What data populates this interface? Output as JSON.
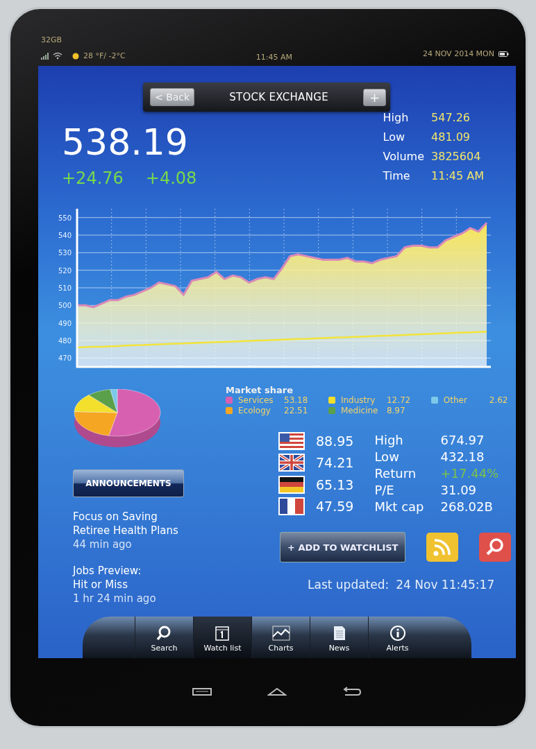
{
  "status_bar": {
    "storage": "32GB",
    "weather": "28 °F/ -2°C",
    "time": "11:45 AM",
    "date": "24 NOV 2014 MON"
  },
  "header": {
    "back": "< Back",
    "title": "STOCK EXCHANGE",
    "add": "+"
  },
  "quote": {
    "price": "538.19",
    "changes": [
      "+24.76",
      "+4.08"
    ],
    "stats": [
      {
        "label": "High",
        "value": "547.26"
      },
      {
        "label": "Low",
        "value": "481.09"
      },
      {
        "label": "Volume",
        "value": "3825604"
      },
      {
        "label": "Time",
        "value": "11:45 AM"
      }
    ]
  },
  "chart_data": {
    "type": "area",
    "grid": true,
    "ylim": [
      465,
      555
    ],
    "yticks": [
      470,
      480,
      490,
      500,
      510,
      520,
      530,
      540,
      550
    ],
    "series": [
      {
        "color": "#f7e55a",
        "values": [
          500,
          500,
          499,
          501,
          503,
          503,
          505,
          506,
          508,
          510,
          513,
          512,
          511,
          506,
          514,
          515,
          516,
          519,
          515,
          517,
          516,
          513,
          515,
          516,
          515,
          521,
          528,
          529,
          528,
          527,
          526,
          526,
          526,
          527,
          525,
          525,
          524,
          526,
          527,
          528,
          533,
          534,
          534,
          533,
          533,
          537,
          539,
          541,
          544,
          542,
          547
        ]
      },
      {
        "type": "line",
        "color": "#f2e43a",
        "values": [
          476,
          476.2,
          476.4,
          476.5,
          476.7,
          476.9,
          477.1,
          477.3,
          477.4,
          477.6,
          477.8,
          478,
          478.2,
          478.3,
          478.5,
          478.7,
          478.9,
          479.1,
          479.2,
          479.4,
          479.6,
          479.8,
          480,
          480.1,
          480.3,
          480.5,
          480.7,
          480.9,
          481,
          481.2,
          481.4,
          481.6,
          481.8,
          481.9,
          482.1,
          482.3,
          482.5,
          482.7,
          482.8,
          483,
          483.2,
          483.4,
          483.6,
          483.7,
          483.9,
          484.1,
          484.3,
          484.5,
          484.6,
          484.8,
          485
        ]
      }
    ]
  },
  "market_share": {
    "title": "Market share",
    "items": [
      {
        "label": "Services",
        "value": "53.18",
        "color": "#d860b0"
      },
      {
        "label": "Ecology",
        "value": "22.51",
        "color": "#f5a623"
      },
      {
        "label": "Industry",
        "value": "12.72",
        "color": "#f2e02c"
      },
      {
        "label": "Medicine",
        "value": "8.97",
        "color": "#5aa04a"
      },
      {
        "label": "Other",
        "value": "2.62",
        "color": "#7ec8e8"
      }
    ]
  },
  "announcements": {
    "button": "ANNOUNCEMENTS",
    "items": [
      {
        "title_lines": [
          "Focus on Saving",
          "Retiree Health Plans"
        ],
        "time": "44 min ago"
      },
      {
        "title_lines": [
          "Jobs Preview:",
          "Hit or Miss"
        ],
        "time": "1 hr 24 min ago"
      }
    ]
  },
  "indices": [
    {
      "kind": "us",
      "value": "88.95"
    },
    {
      "kind": "uk",
      "value": "74.21"
    },
    {
      "kind": "de",
      "value": "65.13"
    },
    {
      "kind": "fr",
      "value": "47.59"
    }
  ],
  "details": [
    {
      "label": "High",
      "value": "674.97",
      "kind": "plain"
    },
    {
      "label": "Low",
      "value": "432.18",
      "kind": "plain"
    },
    {
      "label": "Return",
      "value": "+17.44%",
      "kind": "change"
    },
    {
      "label": "P/E",
      "value": "31.09",
      "kind": "plain"
    },
    {
      "label": "Mkt cap",
      "value": "268.02B",
      "kind": "plain"
    }
  ],
  "watchlist_button": "+ ADD TO WATCHLIST",
  "last_updated": {
    "label": "Last updated:",
    "value": "24 Nov 11:45:17"
  },
  "tabs": [
    {
      "kind": "search",
      "label": "Search",
      "selected": false
    },
    {
      "kind": "calendar",
      "label": "Watch list",
      "selected": true
    },
    {
      "kind": "chart",
      "label": "Charts",
      "selected": false
    },
    {
      "kind": "news",
      "label": "News",
      "selected": false
    },
    {
      "kind": "info",
      "label": "Alerts",
      "selected": false
    }
  ]
}
